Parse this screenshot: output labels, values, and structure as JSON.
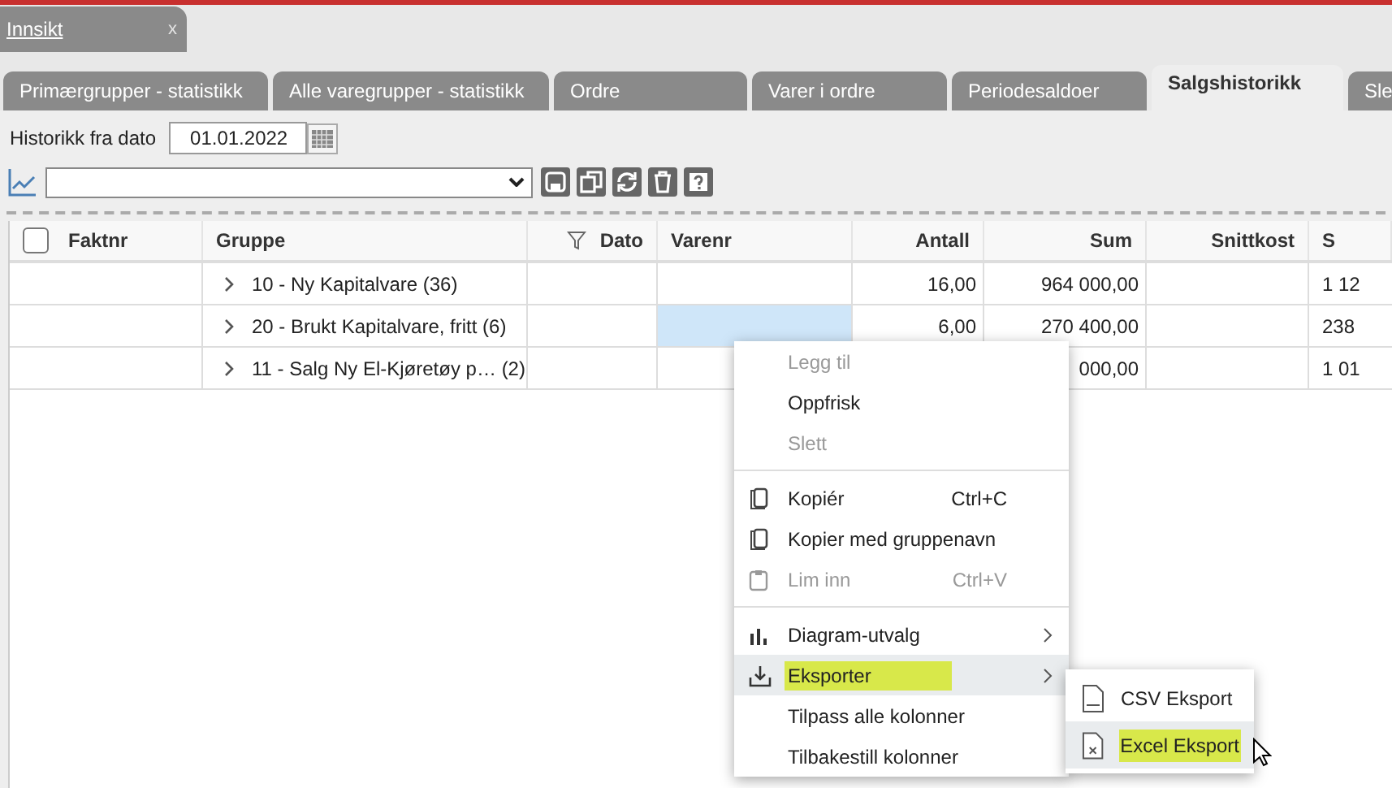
{
  "window_tab": {
    "label": "Innsikt",
    "close": "x"
  },
  "tabs": [
    {
      "label": "Primærgrupper - statistikk",
      "selected": false
    },
    {
      "label": "Alle varegrupper - statistikk",
      "selected": false
    },
    {
      "label": "Ordre",
      "selected": false
    },
    {
      "label": "Varer i ordre",
      "selected": false
    },
    {
      "label": "Periodesaldoer",
      "selected": false
    },
    {
      "label": "Salgshistorikk",
      "selected": true
    },
    {
      "label": "Sle",
      "selected": false
    }
  ],
  "history_filter": {
    "label": "Historikk fra dato",
    "value": "01.01.2022"
  },
  "grid": {
    "select_all_checked": false,
    "columns": [
      {
        "label": "Faktnr"
      },
      {
        "label": "Gruppe"
      },
      {
        "label": "Dato",
        "filter": true
      },
      {
        "label": "Varenr"
      },
      {
        "label": "Antall"
      },
      {
        "label": "Sum"
      },
      {
        "label": "Snittkost"
      },
      {
        "label": "S"
      }
    ],
    "rows": [
      {
        "expanded": false,
        "group": "10 - Ny Kapitalvare (36)",
        "varenr_selected": false,
        "antall": "16,00",
        "sum": "964 000,00",
        "column_8": "1 12"
      },
      {
        "expanded": false,
        "group": "20 - Brukt Kapitalvare, fritt (6)",
        "varenr_selected": true,
        "antall": "6,00",
        "sum": "270 400,00",
        "column_8": "238"
      },
      {
        "expanded": false,
        "group": "11 - Salg Ny El-Kjøretøy p…  (2)",
        "varenr_selected": false,
        "antall": "",
        "sum": "000,00",
        "column_8": "1 01"
      }
    ]
  },
  "context_menu": {
    "items": [
      {
        "kind": "plain",
        "label": "Legg til",
        "disabled": true
      },
      {
        "kind": "plain",
        "label": "Oppfrisk",
        "disabled": false
      },
      {
        "kind": "plain",
        "label": "Slett",
        "disabled": true
      },
      {
        "kind": "separator"
      },
      {
        "kind": "copy",
        "label": "Kopiér",
        "disabled": false,
        "shortcut": "Ctrl+C"
      },
      {
        "kind": "copy",
        "label": "Kopier med gruppenavn",
        "disabled": false
      },
      {
        "kind": "paste",
        "label": "Lim inn",
        "disabled": true,
        "shortcut": "Ctrl+V"
      },
      {
        "kind": "separator"
      },
      {
        "kind": "chart",
        "label": "Diagram-utvalg",
        "disabled": false,
        "submenu": true
      },
      {
        "kind": "export",
        "label": "Eksporter",
        "disabled": false,
        "submenu": true,
        "hovered": true,
        "highlighted": true
      },
      {
        "kind": "plain",
        "label": "Tilpass alle kolonner",
        "disabled": false
      },
      {
        "kind": "plain",
        "label": "Tilbakestill kolonner",
        "disabled": false
      }
    ]
  },
  "submenu": {
    "items": [
      {
        "label": "CSV Eksport",
        "hovered": false,
        "highlighted": false
      },
      {
        "label": "Excel Eksport",
        "hovered": true,
        "highlighted": true
      }
    ]
  }
}
